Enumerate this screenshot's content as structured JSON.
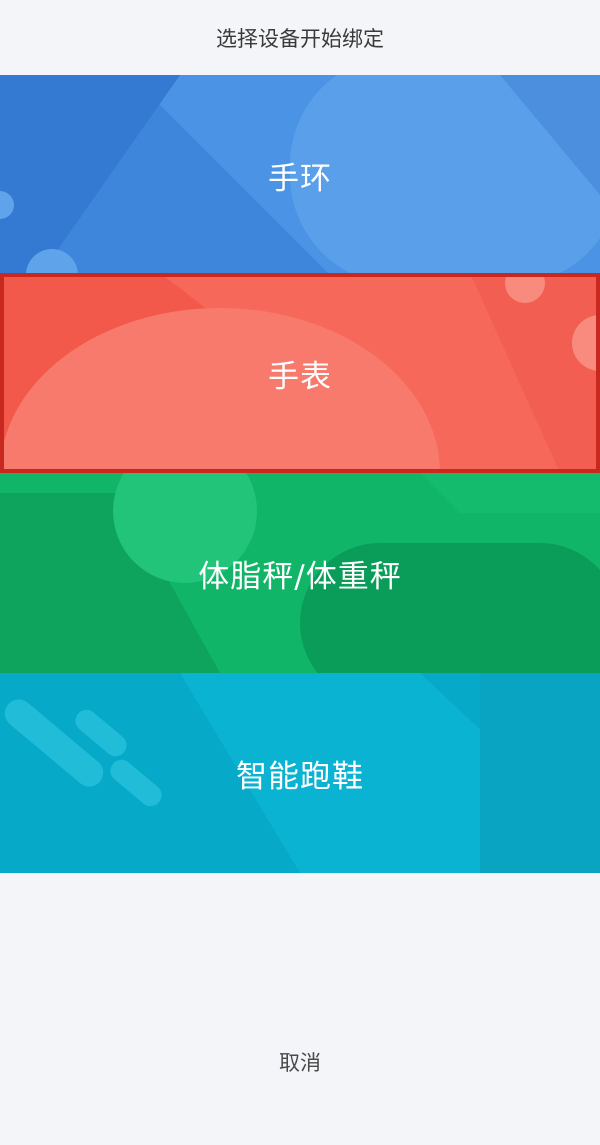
{
  "header": {
    "title": "选择设备开始绑定"
  },
  "devices": [
    {
      "label": "手环",
      "color": "#4a8fe0",
      "selected": false
    },
    {
      "label": "手表",
      "color": "#f46a5a",
      "selected": true
    },
    {
      "label": "体脂秤/体重秤",
      "color": "#12b56a",
      "selected": false
    },
    {
      "label": "智能跑鞋",
      "color": "#08adc9",
      "selected": false
    }
  ],
  "footer": {
    "cancel_label": "取消"
  }
}
